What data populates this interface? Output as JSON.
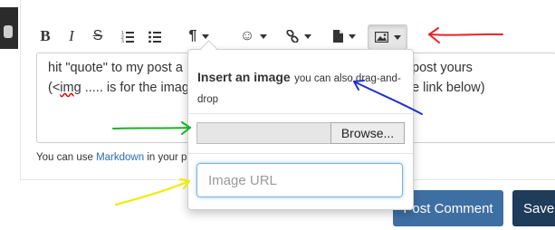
{
  "toolbar": {
    "bold_label": "B",
    "italic_label": "I",
    "strike_label": "S",
    "icons": [
      "bold-icon",
      "italic-icon",
      "strikethrough-icon",
      "ordered-list-icon",
      "unordered-list-icon",
      "paragraph-icon",
      "emoji-icon",
      "link-icon",
      "file-icon",
      "image-icon"
    ]
  },
  "editor": {
    "line1_left": "hit \"quote\" to my post a",
    "line1_right": "post yours",
    "line2_left": "(<img ..... is for the imag",
    "line2_right": "e link below)",
    "misspelled_word": "img"
  },
  "help": {
    "prefix": "You can use ",
    "link": "Markdown",
    "suffix": " in your p"
  },
  "popover": {
    "title": "Insert an image",
    "subtitle": "you can also drag-and-drop",
    "browse_label": "Browse...",
    "url_placeholder": "Image URL"
  },
  "buttons": {
    "post_comment": "Post Comment",
    "save": "Save"
  },
  "annotation_colors": {
    "red": "#e8242a",
    "blue": "#2233cc",
    "green": "#19b02b",
    "yellow": "#f0ea10"
  }
}
